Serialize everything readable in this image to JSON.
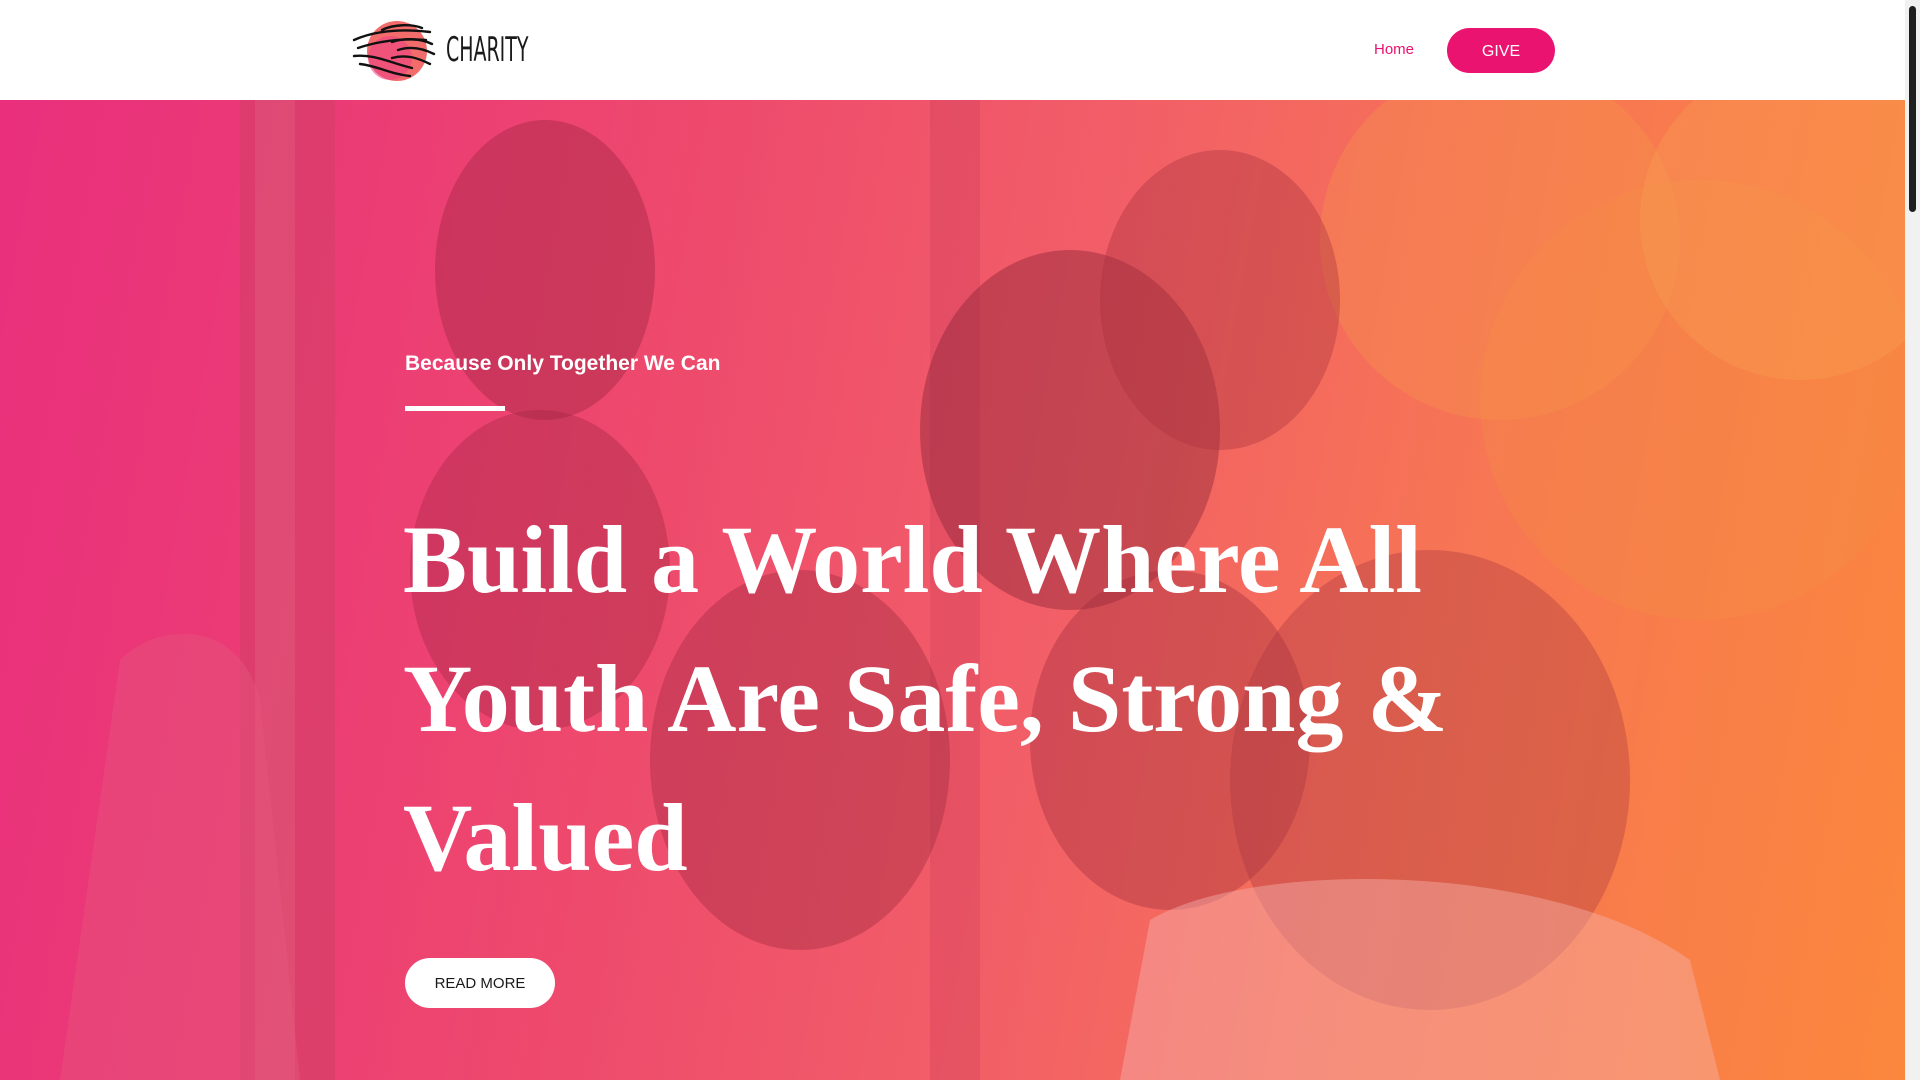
{
  "brand": {
    "logo_text": "CHARITY",
    "colors": {
      "accent": "#eb1370",
      "accent_link": "#e8126f",
      "logo_circle": "#f26c6c"
    }
  },
  "nav": {
    "home_label": "Home",
    "give_label": "GIVE"
  },
  "hero": {
    "tagline": "Because Only Together We Can",
    "headline": "Build a World Where All Youth Are Safe, Strong & Valued",
    "read_more_label": "READ MORE",
    "background_gradient": [
      "#e8337c",
      "#f2616a",
      "#fb8c3d"
    ]
  },
  "icons": {
    "logo_mark": "holding-hands-icon"
  }
}
